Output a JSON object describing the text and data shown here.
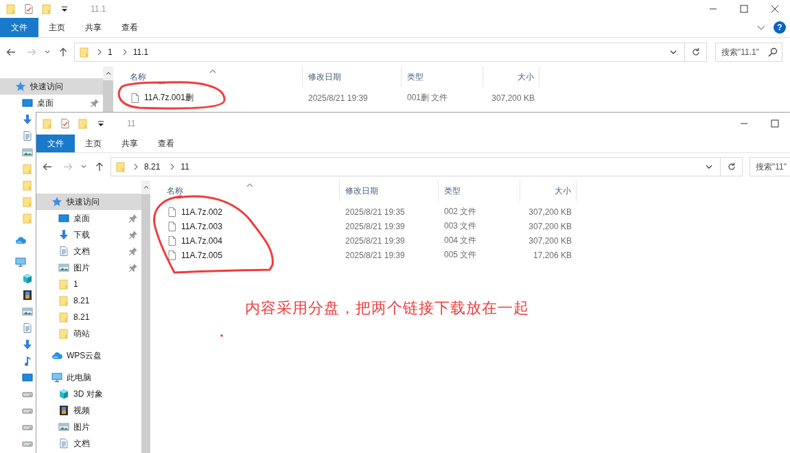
{
  "back_window": {
    "title": "11.1",
    "ribbon": [
      {
        "label": "文件",
        "kind": "menu"
      },
      {
        "label": "主页",
        "kind": "tab"
      },
      {
        "label": "共享",
        "kind": "tab"
      },
      {
        "label": "查看",
        "kind": "tab"
      }
    ],
    "help_button": "?",
    "path": [
      "1",
      "11.1"
    ],
    "search": {
      "placeholder": "搜索\"11.1\""
    },
    "nav": [
      {
        "kind": "quick_access",
        "label": "快速访问",
        "selected": true,
        "children": [
          {
            "kind": "desktop",
            "label": "桌面",
            "selected": false,
            "pinned": true
          },
          {
            "kind": "downloads",
            "selected": false
          },
          {
            "kind": "documents",
            "selected": false
          },
          {
            "kind": "pictures",
            "selected": false
          },
          {
            "kind": "folder",
            "selected": false
          },
          {
            "kind": "folder",
            "selected": false
          },
          {
            "kind": "folder",
            "selected": false
          },
          {
            "kind": "folder",
            "selected": false
          }
        ]
      },
      {
        "kind": "cloud",
        "selected": false
      },
      {
        "kind": "this_pc",
        "selected": false,
        "children": [
          {
            "kind": "objects_3d",
            "selected": false
          },
          {
            "kind": "videos",
            "selected": false
          },
          {
            "kind": "pictures",
            "selected": false
          },
          {
            "kind": "documents",
            "selected": false
          },
          {
            "kind": "downloads",
            "selected": false
          },
          {
            "kind": "music",
            "selected": false
          },
          {
            "kind": "desktop",
            "selected": false
          },
          {
            "kind": "drive",
            "selected": false
          },
          {
            "kind": "drive",
            "selected": false
          },
          {
            "kind": "drive",
            "selected": false
          },
          {
            "kind": "drive",
            "selected": false
          }
        ]
      }
    ],
    "columns": [
      "名称",
      "修改日期",
      "类型",
      "大小"
    ],
    "rows": [
      {
        "name": "11A.7z.001删",
        "modified": "2025/8/21 19:39",
        "type": "001删 文件",
        "size": "307,200 KB"
      }
    ]
  },
  "front_window": {
    "title": "11",
    "ribbon": [
      {
        "label": "文件",
        "kind": "menu"
      },
      {
        "label": "主页",
        "kind": "tab"
      },
      {
        "label": "共享",
        "kind": "tab"
      },
      {
        "label": "查看",
        "kind": "tab"
      }
    ],
    "path": [
      "8.21",
      "11"
    ],
    "search": {
      "placeholder": "搜索\"11\""
    },
    "nav": [
      {
        "kind": "quick_access",
        "label": "快速访问",
        "selected": true,
        "children": [
          {
            "kind": "desktop",
            "label": "桌面",
            "selected": false,
            "pinned": true
          },
          {
            "kind": "downloads",
            "label": "下载",
            "selected": false,
            "pinned": true
          },
          {
            "kind": "documents",
            "label": "文档",
            "selected": false,
            "pinned": true
          },
          {
            "kind": "pictures",
            "label": "图片",
            "selected": false,
            "pinned": true
          },
          {
            "kind": "folder",
            "label": "1",
            "selected": false,
            "pinned": false
          },
          {
            "kind": "folder",
            "label": "8.21",
            "selected": false,
            "pinned": false
          },
          {
            "kind": "folder",
            "label": "8.21",
            "selected": false,
            "pinned": false
          },
          {
            "kind": "folder",
            "label": "萌站",
            "selected": false,
            "pinned": false
          }
        ]
      },
      {
        "kind": "cloud",
        "label": "WPS云盘",
        "selected": false
      },
      {
        "kind": "this_pc",
        "label": "此电脑",
        "selected": false,
        "children": [
          {
            "kind": "objects_3d",
            "label": "3D 对象",
            "selected": false
          },
          {
            "kind": "videos",
            "label": "视频",
            "selected": false
          },
          {
            "kind": "pictures",
            "label": "图片",
            "selected": false
          },
          {
            "kind": "documents",
            "label": "文档",
            "selected": false
          }
        ]
      }
    ],
    "columns": [
      "名称",
      "修改日期",
      "类型",
      "大小"
    ],
    "rows": [
      {
        "name": "11A.7z.002",
        "modified": "2025/8/21 19:35",
        "type": "002 文件",
        "size": "307,200 KB"
      },
      {
        "name": "11A.7z.003",
        "modified": "2025/8/21 19:39",
        "type": "003 文件",
        "size": "307,200 KB"
      },
      {
        "name": "11A.7z.004",
        "modified": "2025/8/21 19:39",
        "type": "004 文件",
        "size": "307,200 KB"
      },
      {
        "name": "11A.7z.005",
        "modified": "2025/8/21 19:39",
        "type": "005 文件",
        "size": "17,206 KB"
      }
    ]
  },
  "annotation": {
    "note": "内容采用分盘，把两个链接下载放在一起"
  }
}
